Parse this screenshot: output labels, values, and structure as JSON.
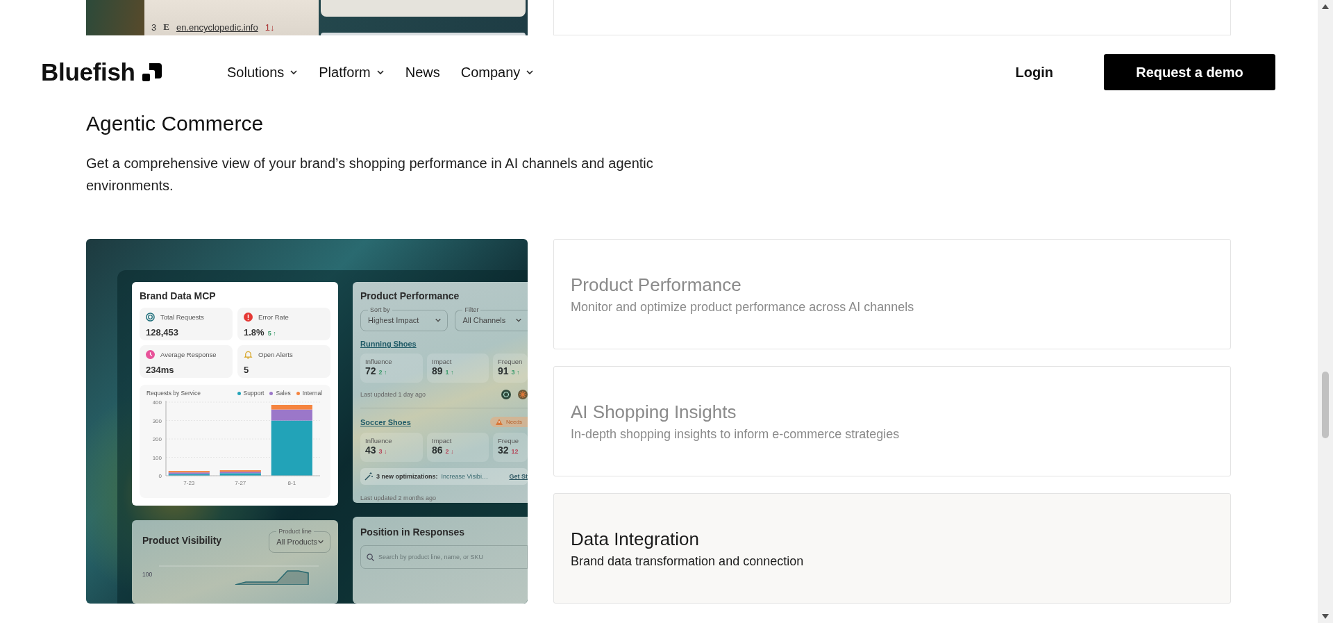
{
  "previous_section": {
    "rank": "3",
    "source_letter": "E",
    "domain": "en.encyclopedic.info",
    "change": "1↓"
  },
  "header": {
    "logo": "Bluefish",
    "nav": [
      {
        "label": "Solutions",
        "dropdown": true
      },
      {
        "label": "Platform",
        "dropdown": true
      },
      {
        "label": "News",
        "dropdown": false
      },
      {
        "label": "Company",
        "dropdown": true
      }
    ],
    "login": "Login",
    "cta": "Request a demo"
  },
  "section": {
    "title": "Agentic Commerce",
    "description": "Get a comprehensive view of your brand’s shopping performance in AI channels and agentic environments."
  },
  "dashboard": {
    "brand_data": {
      "title": "Brand Data MCP",
      "stats": [
        {
          "kind": "requests",
          "label": "Total Requests",
          "value": "128,453"
        },
        {
          "kind": "error",
          "label": "Error Rate",
          "value": "1.8%",
          "change": "5 ↑",
          "color": "#3a9a6a"
        },
        {
          "kind": "clock",
          "label": "Average Response",
          "value": "234ms"
        },
        {
          "kind": "alert",
          "label": "Open Alerts",
          "value": "5"
        }
      ],
      "chart": {
        "chart_data": {
          "type": "bar",
          "title": "Requests by Service",
          "categories": [
            "7-23",
            "7-27",
            "8-1"
          ],
          "stacked": true,
          "grid": true,
          "ylim": [
            0,
            400
          ],
          "yticks": [
            0,
            100,
            200,
            300,
            400
          ],
          "series": [
            {
              "name": "Support",
              "color": "#22a3b8",
              "values": [
                10,
                14,
                300
              ]
            },
            {
              "name": "Sales",
              "color": "#9b77c9",
              "values": [
                8,
                8,
                60
              ]
            },
            {
              "name": "Internal",
              "color": "#f5843f",
              "values": [
                8,
                8,
                25
              ]
            }
          ]
        }
      }
    },
    "product_performance": {
      "title": "Product Performance",
      "sort": {
        "label": "Sort by",
        "value": "Highest Impact"
      },
      "filter": {
        "label": "Filter",
        "value": "All Channels"
      },
      "products": [
        {
          "name": "Running Shoes",
          "metrics": [
            {
              "label": "Influence",
              "value": "72",
              "change": "2 ↑",
              "color": "#3a9a6a"
            },
            {
              "label": "Impact",
              "value": "89",
              "change": "1 ↑",
              "color": "#3a9a6a"
            },
            {
              "label": "Frequen",
              "value": "91",
              "change": "3 ↑",
              "color": "#3a9a6a"
            }
          ],
          "updated": "Last updated 1 day ago"
        },
        {
          "name": "Soccer Shoes",
          "badge": "Needs",
          "metrics": [
            {
              "label": "Influence",
              "value": "43",
              "change": "3 ↓",
              "color": "#b4475a"
            },
            {
              "label": "Impact",
              "value": "86",
              "change": "2 ↓",
              "color": "#b4475a"
            },
            {
              "label": "Freque",
              "value": "32",
              "change": "12",
              "color": "#b4475a"
            }
          ],
          "optimizations": {
            "count_text": "3 new optimizations:",
            "detail": "Increase Visibi…",
            "link": "Get St"
          },
          "updated": "Last updated 2 months ago"
        }
      ]
    },
    "product_visibility": {
      "title": "Product Visibility",
      "select": {
        "label": "Product line",
        "value": "All Products"
      },
      "tick": "100"
    },
    "position_in_responses": {
      "title": "Position in Responses",
      "search_placeholder": "Search by product line, name, or SKU"
    }
  },
  "features": [
    {
      "title": "Product Performance",
      "description": "Monitor and optimize product performance across AI channels",
      "selected": false
    },
    {
      "title": "AI Shopping Insights",
      "description": "In-depth shopping insights to inform e-commerce strategies",
      "selected": false
    },
    {
      "title": "Data Integration",
      "description": "Brand data transformation and connection",
      "selected": true
    }
  ]
}
